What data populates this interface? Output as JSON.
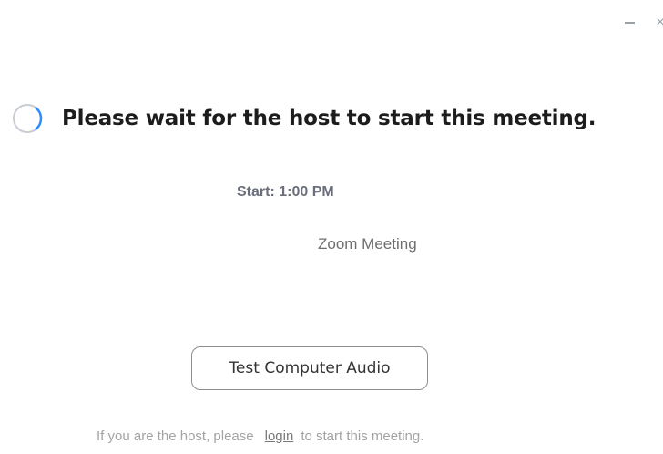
{
  "window": {
    "controls": {
      "minimize_icon": "minimize-icon",
      "close_icon": "close-icon",
      "close_glyph": "×"
    }
  },
  "waiting": {
    "status_icon": "loading-spinner-icon",
    "title": "Please wait for the host to start this meeting.",
    "start_time": "Start: 1:00 PM",
    "topic": "Zoom Meeting"
  },
  "actions": {
    "test_audio_label": "Test Computer Audio"
  },
  "host_note": {
    "prefix": "If you are the host, please",
    "link_label": "login",
    "suffix": "to start this meeting."
  },
  "colors": {
    "spinner_track": "#c9ccd3",
    "spinner_arc": "#2d8cff",
    "title": "#1c1c1c",
    "muted_text": "#a3a3a3"
  }
}
